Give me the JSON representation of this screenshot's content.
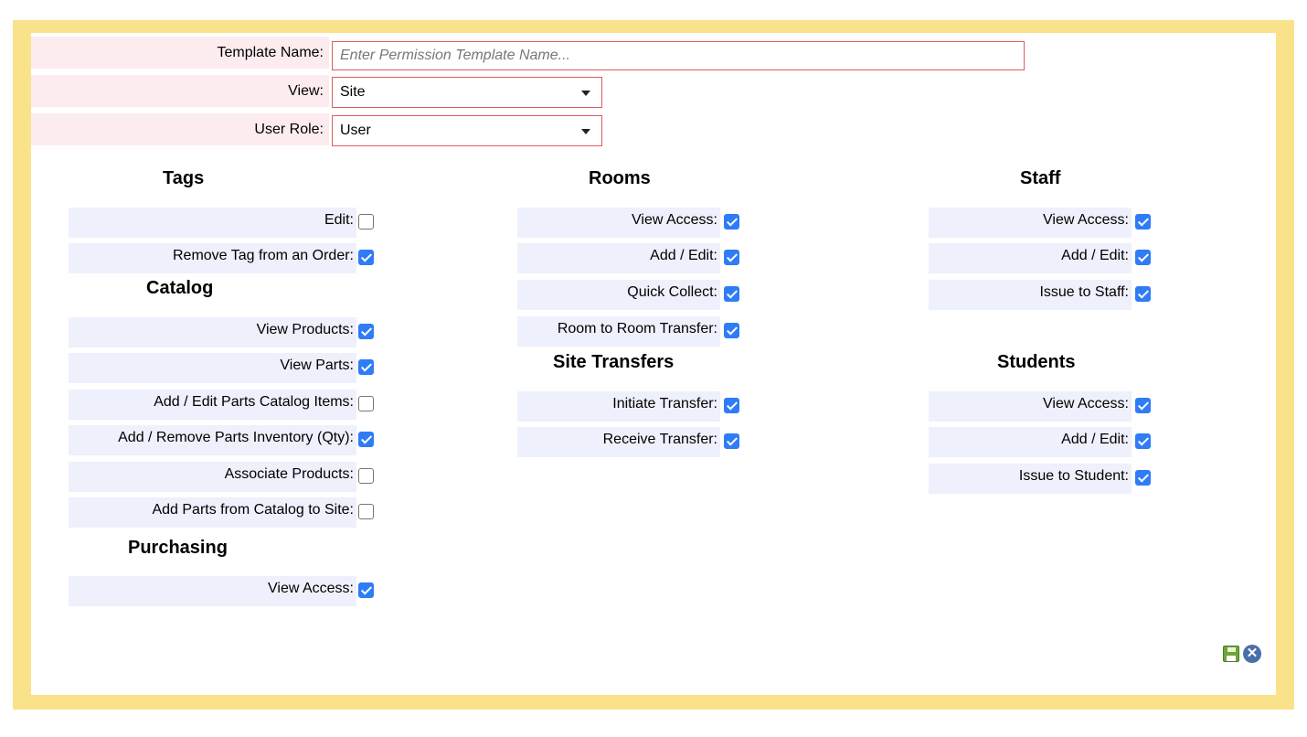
{
  "form": {
    "template_name_label": "Template Name:",
    "template_name_placeholder": "Enter Permission Template Name...",
    "template_name_value": "",
    "view_label": "View:",
    "view_value": "Site",
    "role_label": "User Role:",
    "role_value": "User"
  },
  "sections": {
    "tags": {
      "title": "Tags",
      "items": [
        {
          "label": "Edit:",
          "checked": false
        },
        {
          "label": "Remove Tag from an Order:",
          "checked": true
        }
      ]
    },
    "catalog": {
      "title": "Catalog",
      "items": [
        {
          "label": "View Products:",
          "checked": true
        },
        {
          "label": "View Parts:",
          "checked": true
        },
        {
          "label": "Add / Edit Parts Catalog Items:",
          "checked": false
        },
        {
          "label": "Add / Remove Parts Inventory (Qty):",
          "checked": true
        },
        {
          "label": "Associate Products:",
          "checked": false
        },
        {
          "label": "Add Parts from Catalog to Site:",
          "checked": false
        }
      ]
    },
    "purchasing": {
      "title": "Purchasing",
      "items": [
        {
          "label": "View Access:",
          "checked": true
        }
      ]
    },
    "rooms": {
      "title": "Rooms",
      "items": [
        {
          "label": "View Access:",
          "checked": true
        },
        {
          "label": "Add / Edit:",
          "checked": true
        },
        {
          "label": "Quick Collect:",
          "checked": true
        },
        {
          "label": "Room to Room Transfer:",
          "checked": true
        }
      ]
    },
    "site_transfers": {
      "title": "Site Transfers",
      "items": [
        {
          "label": "Initiate Transfer:",
          "checked": true
        },
        {
          "label": "Receive Transfer:",
          "checked": true
        }
      ]
    },
    "staff": {
      "title": "Staff",
      "items": [
        {
          "label": "View Access:",
          "checked": true
        },
        {
          "label": "Add / Edit:",
          "checked": true
        },
        {
          "label": "Issue to Staff:",
          "checked": true
        }
      ]
    },
    "students": {
      "title": "Students",
      "items": [
        {
          "label": "View Access:",
          "checked": true
        },
        {
          "label": "Add / Edit:",
          "checked": true
        },
        {
          "label": "Issue to Student:",
          "checked": true
        }
      ]
    }
  },
  "icons": {
    "save": "save-icon",
    "cancel": "cancel-icon"
  },
  "colors": {
    "frame": "#fae28a",
    "checkbox_on": "#2f7cf6",
    "field_border": "#e05a5a"
  }
}
